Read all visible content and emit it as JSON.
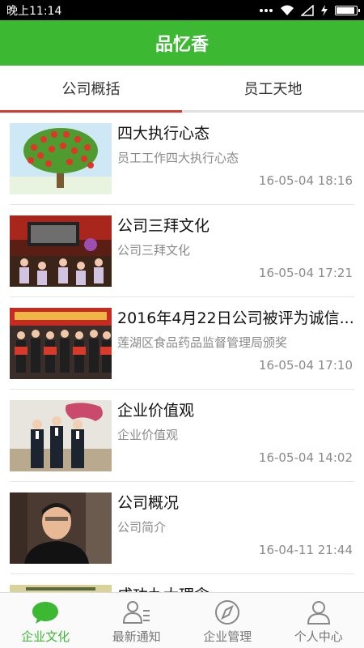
{
  "status_bar": {
    "time": "晚上11:14"
  },
  "app": {
    "title": "品忆香",
    "accent": "#3cb832",
    "tab_indicator_color": "#d9382e"
  },
  "tabs": [
    {
      "label": "公司概括",
      "active": true
    },
    {
      "label": "员工天地",
      "active": false
    }
  ],
  "articles": [
    {
      "title": "四大执行心态",
      "subtitle": "员工工作四大执行心态",
      "time": "16-05-04 18:16",
      "thumb": "tree-image"
    },
    {
      "title": "公司三拜文化",
      "subtitle": "公司三拜文化",
      "time": "16-05-04 17:21",
      "thumb": "event-stage-image"
    },
    {
      "title": "2016年4月22日公司被评为诚信...",
      "subtitle": "莲湖区食品药品监督管理局颁奖",
      "time": "16-05-04 17:10",
      "thumb": "award-ceremony-image"
    },
    {
      "title": "企业价值观",
      "subtitle": "企业价值观",
      "time": "16-05-04 14:02",
      "thumb": "group-photo-image"
    },
    {
      "title": "公司概况",
      "subtitle": "公司简介",
      "time": "16-04-11 21:44",
      "thumb": "portrait-image"
    },
    {
      "title": "成功九大理念",
      "subtitle": "",
      "time": "",
      "thumb": "book-cover-image"
    }
  ],
  "bottom_nav": [
    {
      "label": "企业文化",
      "icon": "chat-bubble-icon",
      "active": true
    },
    {
      "label": "最新通知",
      "icon": "person-list-icon",
      "active": false
    },
    {
      "label": "企业管理",
      "icon": "compass-icon",
      "active": false
    },
    {
      "label": "个人中心",
      "icon": "person-icon",
      "active": false
    }
  ]
}
